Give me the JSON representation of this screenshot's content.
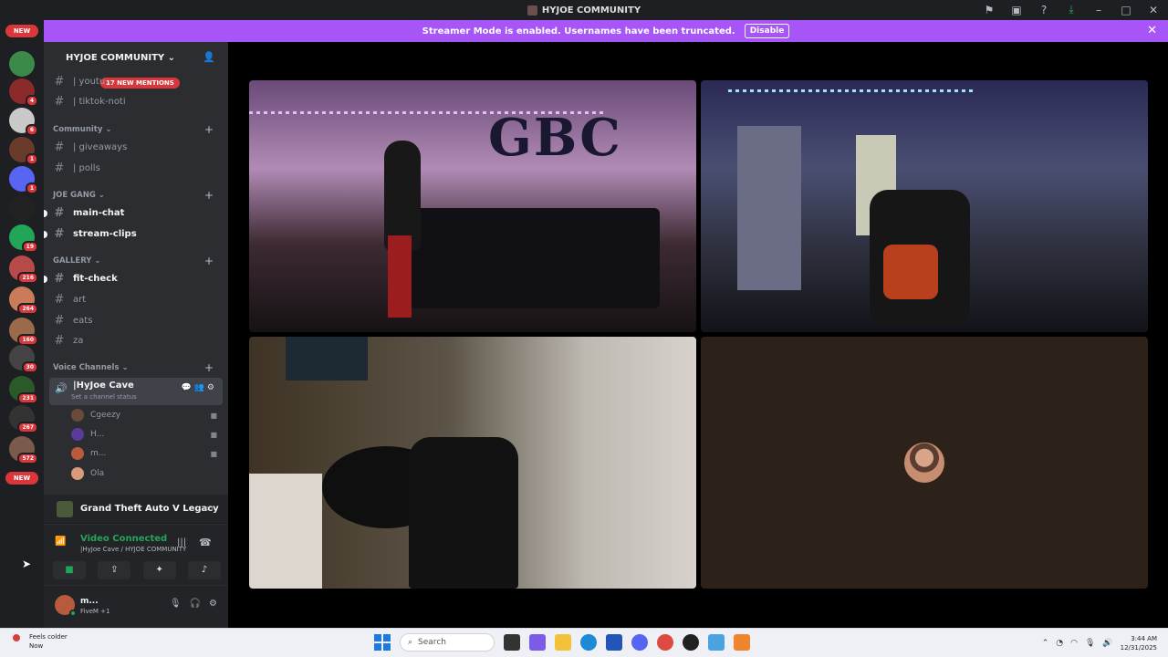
{
  "window": {
    "title": "HYJOE COMMUNITY",
    "icons": [
      "inbox-flag-icon",
      "monitor-icon",
      "help-icon",
      "download-icon",
      "minimize-icon",
      "maximize-icon",
      "close-icon"
    ]
  },
  "banner": {
    "text": "Streamer Mode is enabled. Usernames have been truncated.",
    "button": "Disable",
    "close": "✕",
    "color": "#a855f7"
  },
  "guilds": {
    "top_pill": "NEW",
    "bottom_pill": "NEW",
    "badges": [
      "4",
      "6",
      "1",
      "1",
      "19",
      "216",
      "264",
      "160",
      "30",
      "231",
      "267",
      "572"
    ]
  },
  "server": {
    "header": "HYJOE COMMUNITY",
    "mentions": "17 NEW MENTIONS"
  },
  "channels": [
    {
      "name": "| youtu...",
      "unread": false
    },
    {
      "name": "| tiktok-noti",
      "unread": false
    }
  ],
  "categories": {
    "community": "Community",
    "joe_gang": "JOE GANG",
    "gallery": "GALLERY",
    "voice": "Voice Channels"
  },
  "community_channels": [
    "| giveaways",
    "| polls"
  ],
  "joe_gang_channels": [
    "main-chat",
    "stream-clips"
  ],
  "gallery_channels": [
    "fit-check",
    "art",
    "eats",
    "za"
  ],
  "voice_channel": {
    "name": "|HyJoe Cave",
    "status": "Set a channel status"
  },
  "voice_users": [
    "Cgeezy",
    "H...",
    "m...",
    "Ola"
  ],
  "activity": {
    "game": "Grand Theft Auto V Legacy"
  },
  "rtc": {
    "title": "Video Connected",
    "subtitle": "|HyJoe Cave / HYJOE COMMUNITY"
  },
  "user": {
    "name": "m...",
    "status": "FiveM +1"
  },
  "video": {
    "wall_text": "GBC"
  },
  "taskbar": {
    "weather": "Feels colder",
    "weather_sub": "Now",
    "search_placeholder": "Search",
    "time": "3:44 AM",
    "date": "12/31/2025"
  }
}
